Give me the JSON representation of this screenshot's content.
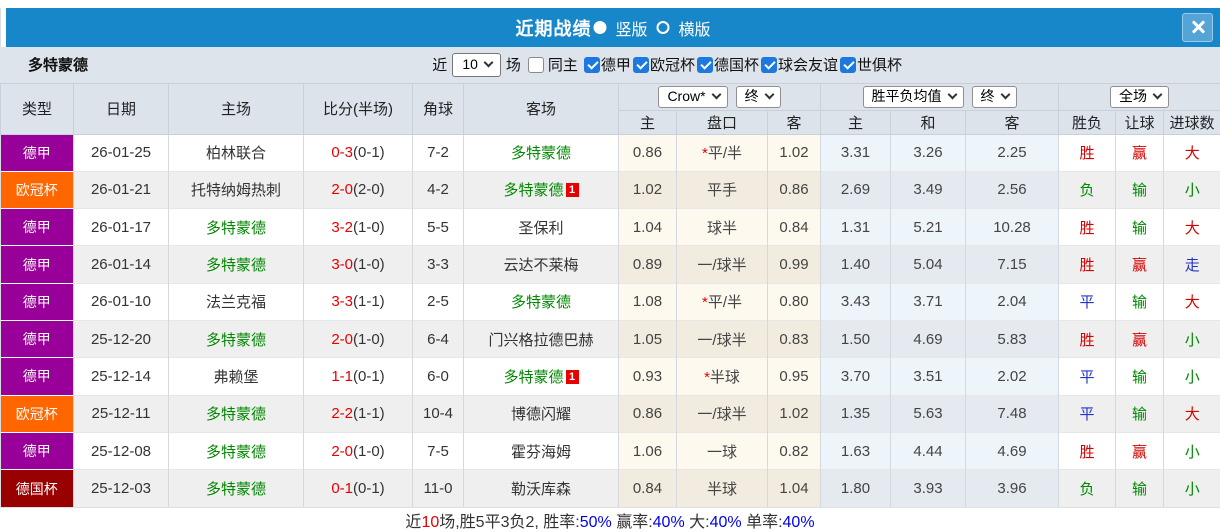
{
  "titlebar": {
    "title": "近期战绩",
    "radios": [
      {
        "label": "竖版",
        "selected": true
      },
      {
        "label": "横版",
        "selected": false
      }
    ]
  },
  "filterbar": {
    "team": "多特蒙德",
    "near_label": "近",
    "match_count": "10",
    "games_label": "场",
    "checkboxes": [
      {
        "label": "同主",
        "checked": false
      },
      {
        "label": "德甲",
        "checked": true
      },
      {
        "label": "欧冠杯",
        "checked": true
      },
      {
        "label": "德国杯",
        "checked": true
      },
      {
        "label": "球会友谊",
        "checked": true
      },
      {
        "label": "世俱杯",
        "checked": true
      }
    ]
  },
  "table": {
    "main_headers": [
      "类型",
      "日期",
      "主场",
      "比分(半场)",
      "角球",
      "客场"
    ],
    "group_dropdowns": {
      "odds_source": "Crow*",
      "odds_time": "终",
      "mean_source": "胜平负均值",
      "mean_time": "终",
      "goals_scope": "全场"
    },
    "sub_headers": [
      "主",
      "盘口",
      "客",
      "主",
      "和",
      "客",
      "胜负",
      "让球",
      "进球数"
    ],
    "type_colors": {
      "德甲": "#990099",
      "欧冠杯": "#ff6600",
      "德国杯": "#990000"
    },
    "rows": [
      {
        "type": "德甲",
        "date": "26-01-25",
        "home": "柏林联合",
        "home_self": false,
        "home_badge": "",
        "score_ft": "0-3",
        "score_ht": "(0-1)",
        "corner": "7-2",
        "away": "多特蒙德",
        "away_self": true,
        "away_badge": "",
        "odds_home": "0.86",
        "handicap": "平/半",
        "handicap_star": true,
        "odds_away": "1.02",
        "mean_home": "3.31",
        "mean_draw": "3.26",
        "mean_away": "2.25",
        "sf": "胜",
        "sf_c": "red",
        "rq": "赢",
        "rq_c": "red",
        "jq": "大",
        "jq_c": "red"
      },
      {
        "type": "欧冠杯",
        "date": "26-01-21",
        "home": "托特纳姆热刺",
        "home_self": false,
        "home_badge": "",
        "score_ft": "2-0",
        "score_ht": "(2-0)",
        "corner": "4-2",
        "away": "多特蒙德",
        "away_self": true,
        "away_badge": "1",
        "odds_home": "1.02",
        "handicap": "平手",
        "handicap_star": false,
        "odds_away": "0.86",
        "mean_home": "2.69",
        "mean_draw": "3.49",
        "mean_away": "2.56",
        "sf": "负",
        "sf_c": "green",
        "rq": "输",
        "rq_c": "green",
        "jq": "小",
        "jq_c": "green"
      },
      {
        "type": "德甲",
        "date": "26-01-17",
        "home": "多特蒙德",
        "home_self": true,
        "home_badge": "",
        "score_ft": "3-2",
        "score_ht": "(1-0)",
        "corner": "5-5",
        "away": "圣保利",
        "away_self": false,
        "away_badge": "",
        "odds_home": "1.04",
        "handicap": "球半",
        "handicap_star": false,
        "odds_away": "0.84",
        "mean_home": "1.31",
        "mean_draw": "5.21",
        "mean_away": "10.28",
        "sf": "胜",
        "sf_c": "red",
        "rq": "输",
        "rq_c": "green",
        "jq": "大",
        "jq_c": "red"
      },
      {
        "type": "德甲",
        "date": "26-01-14",
        "home": "多特蒙德",
        "home_self": true,
        "home_badge": "",
        "score_ft": "3-0",
        "score_ht": "(1-0)",
        "corner": "3-3",
        "away": "云达不莱梅",
        "away_self": false,
        "away_badge": "",
        "odds_home": "0.89",
        "handicap": "一/球半",
        "handicap_star": false,
        "odds_away": "0.99",
        "mean_home": "1.40",
        "mean_draw": "5.04",
        "mean_away": "7.15",
        "sf": "胜",
        "sf_c": "red",
        "rq": "赢",
        "rq_c": "red",
        "jq": "走",
        "jq_c": "blue"
      },
      {
        "type": "德甲",
        "date": "26-01-10",
        "home": "法兰克福",
        "home_self": false,
        "home_badge": "",
        "score_ft": "3-3",
        "score_ht": "(1-1)",
        "corner": "2-5",
        "away": "多特蒙德",
        "away_self": true,
        "away_badge": "",
        "odds_home": "1.08",
        "handicap": "平/半",
        "handicap_star": true,
        "odds_away": "0.80",
        "mean_home": "3.43",
        "mean_draw": "3.71",
        "mean_away": "2.04",
        "sf": "平",
        "sf_c": "blue",
        "rq": "输",
        "rq_c": "green",
        "jq": "大",
        "jq_c": "red"
      },
      {
        "type": "德甲",
        "date": "25-12-20",
        "home": "多特蒙德",
        "home_self": true,
        "home_badge": "",
        "score_ft": "2-0",
        "score_ht": "(1-0)",
        "corner": "6-4",
        "away": "门兴格拉德巴赫",
        "away_self": false,
        "away_badge": "",
        "odds_home": "1.05",
        "handicap": "一/球半",
        "handicap_star": false,
        "odds_away": "0.83",
        "mean_home": "1.50",
        "mean_draw": "4.69",
        "mean_away": "5.83",
        "sf": "胜",
        "sf_c": "red",
        "rq": "赢",
        "rq_c": "red",
        "jq": "小",
        "jq_c": "green"
      },
      {
        "type": "德甲",
        "date": "25-12-14",
        "home": "弗赖堡",
        "home_self": false,
        "home_badge": "",
        "score_ft": "1-1",
        "score_ht": "(0-1)",
        "corner": "6-0",
        "away": "多特蒙德",
        "away_self": true,
        "away_badge": "1",
        "odds_home": "0.93",
        "handicap": "半球",
        "handicap_star": true,
        "odds_away": "0.95",
        "mean_home": "3.70",
        "mean_draw": "3.51",
        "mean_away": "2.02",
        "sf": "平",
        "sf_c": "blue",
        "rq": "输",
        "rq_c": "green",
        "jq": "小",
        "jq_c": "green"
      },
      {
        "type": "欧冠杯",
        "date": "25-12-11",
        "home": "多特蒙德",
        "home_self": true,
        "home_badge": "",
        "score_ft": "2-2",
        "score_ht": "(1-1)",
        "corner": "10-4",
        "away": "博德闪耀",
        "away_self": false,
        "away_badge": "",
        "odds_home": "0.86",
        "handicap": "一/球半",
        "handicap_star": false,
        "odds_away": "1.02",
        "mean_home": "1.35",
        "mean_draw": "5.63",
        "mean_away": "7.48",
        "sf": "平",
        "sf_c": "blue",
        "rq": "输",
        "rq_c": "green",
        "jq": "大",
        "jq_c": "red"
      },
      {
        "type": "德甲",
        "date": "25-12-08",
        "home": "多特蒙德",
        "home_self": true,
        "home_badge": "",
        "score_ft": "2-0",
        "score_ht": "(1-0)",
        "corner": "7-5",
        "away": "霍芬海姆",
        "away_self": false,
        "away_badge": "",
        "odds_home": "1.06",
        "handicap": "一球",
        "handicap_star": false,
        "odds_away": "0.82",
        "mean_home": "1.63",
        "mean_draw": "4.44",
        "mean_away": "4.69",
        "sf": "胜",
        "sf_c": "red",
        "rq": "赢",
        "rq_c": "red",
        "jq": "小",
        "jq_c": "green"
      },
      {
        "type": "德国杯",
        "date": "25-12-03",
        "home": "多特蒙德",
        "home_self": true,
        "home_badge": "",
        "score_ft": "0-1",
        "score_ht": "(0-1)",
        "corner": "11-0",
        "away": "勒沃库森",
        "away_self": false,
        "away_badge": "",
        "odds_home": "0.84",
        "handicap": "半球",
        "handicap_star": false,
        "odds_away": "1.04",
        "mean_home": "1.80",
        "mean_draw": "3.93",
        "mean_away": "3.96",
        "sf": "负",
        "sf_c": "green",
        "rq": "输",
        "rq_c": "green",
        "jq": "小",
        "jq_c": "green"
      }
    ]
  },
  "footer": {
    "segments": [
      {
        "text": "近",
        "color": "#333333"
      },
      {
        "text": "10",
        "color": "#e60000"
      },
      {
        "text": "场,胜5平3负2, 胜率:",
        "color": "#333333"
      },
      {
        "text": "50%",
        "color": "#0000ee"
      },
      {
        "text": " 赢率:",
        "color": "#333333"
      },
      {
        "text": "40%",
        "color": "#0000ee"
      },
      {
        "text": " 大:",
        "color": "#333333"
      },
      {
        "text": "40%",
        "color": "#0000ee"
      },
      {
        "text": " 单率:",
        "color": "#333333"
      },
      {
        "text": "40%",
        "color": "#0000ee"
      }
    ]
  }
}
